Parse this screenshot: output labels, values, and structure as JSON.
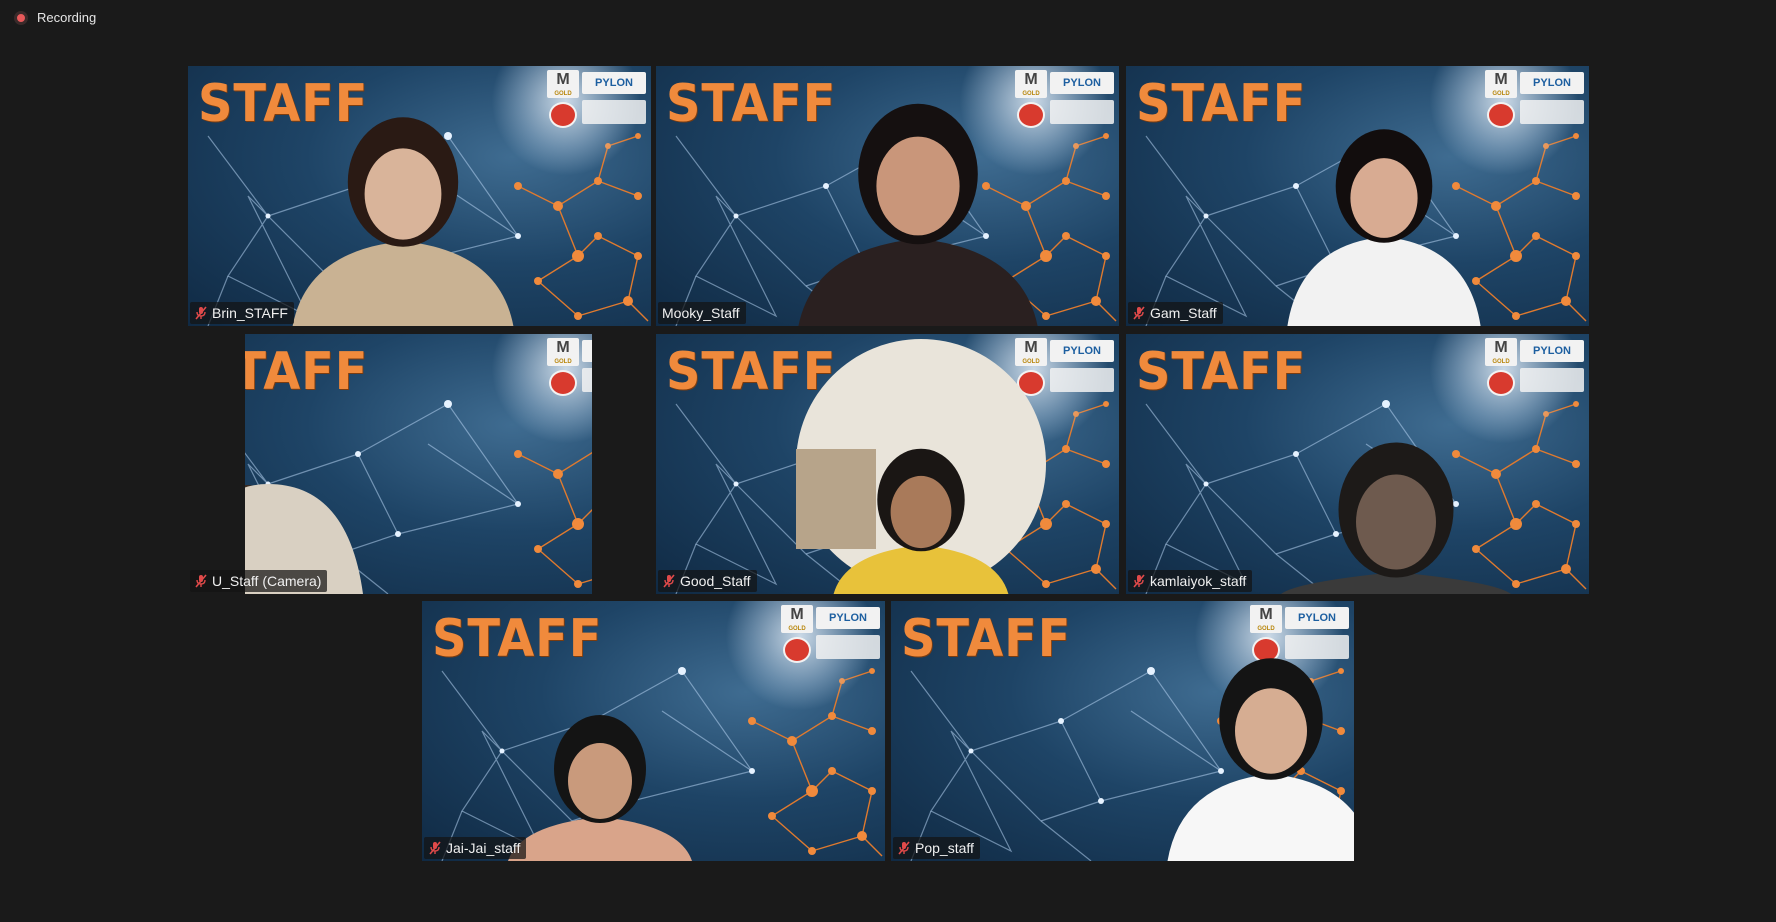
{
  "recording": {
    "label": "Recording",
    "color": "#e8595a"
  },
  "banner": {
    "title": "STAFF",
    "logo_m": "M",
    "logo_m_sub": "GOLD",
    "logo_p": "PYLON"
  },
  "participants": [
    {
      "name": "Brin_STAFF",
      "muted": true
    },
    {
      "name": "Mooky_Staff",
      "muted": false
    },
    {
      "name": "Gam_Staff",
      "muted": true
    },
    {
      "name": "U_Staff (Camera)",
      "muted": true
    },
    {
      "name": "Good_Staff",
      "muted": true
    },
    {
      "name": "kamlaiyok_staff",
      "muted": true
    },
    {
      "name": "Jai-Jai_staff",
      "muted": true
    },
    {
      "name": "Pop_staff",
      "muted": true
    }
  ],
  "colors": {
    "accent_orange": "#f08a3c",
    "mute_red": "#e04a4a",
    "background": "#1a1a1a"
  }
}
